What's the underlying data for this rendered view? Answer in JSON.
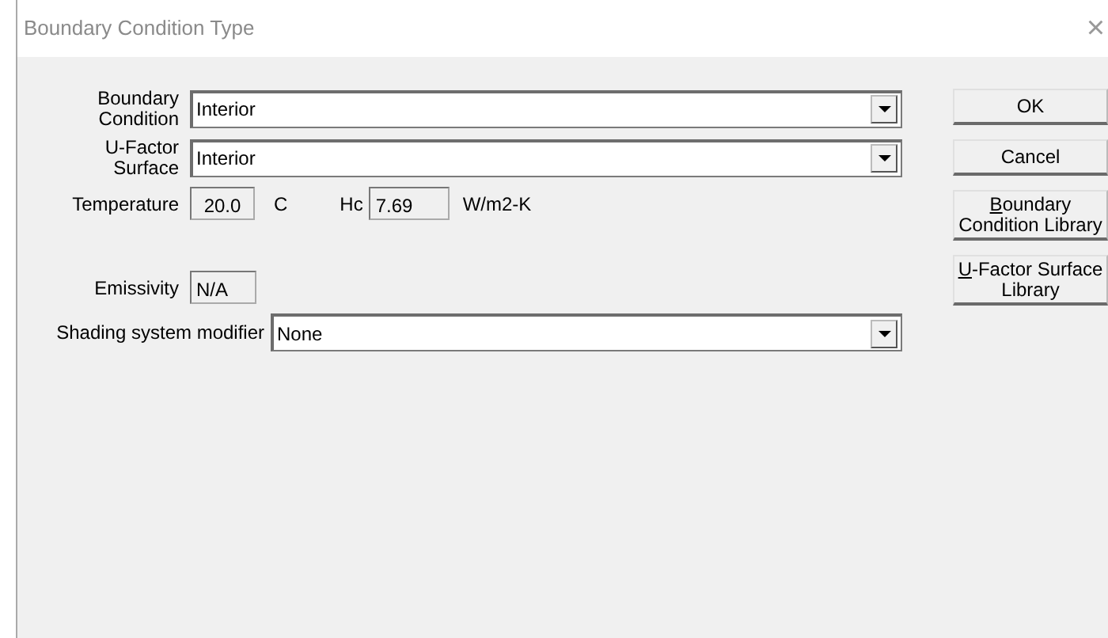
{
  "window": {
    "title": "Boundary Condition Type",
    "close": "×"
  },
  "boundary_condition": {
    "label": "Boundary\nCondition",
    "value": "Interior"
  },
  "u_factor_surface": {
    "label": "U-Factor\nSurface",
    "value": "Interior"
  },
  "temperature": {
    "label": "Temperature",
    "value": "20.0",
    "unit": "C"
  },
  "hc": {
    "label": "Hc",
    "value": "7.69",
    "unit": "W/m2-K"
  },
  "emissivity": {
    "label": "Emissivity",
    "value": "N/A"
  },
  "shading_system_modifier": {
    "label": "Shading system modifier",
    "value": "None"
  },
  "buttons": [
    {
      "rest": "OK"
    },
    {
      "rest": "Cancel"
    },
    {
      "access_key": "B",
      "rest": "oundary\nCondition Library"
    },
    {
      "access_key": "U",
      "rest": "-Factor Surface\nLibrary"
    }
  ]
}
